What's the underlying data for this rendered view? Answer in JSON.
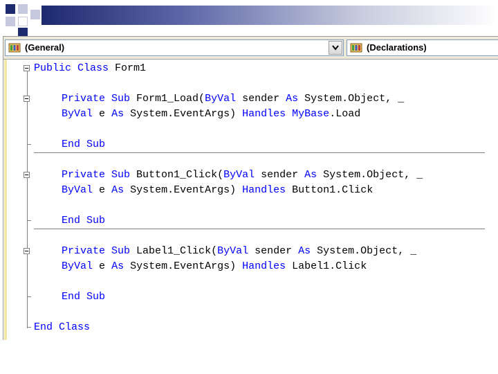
{
  "navbar": {
    "class_combo": {
      "value": "(General)"
    },
    "method_combo": {
      "value": "(Declarations)"
    }
  },
  "code": {
    "class_decl": [
      "Public Class",
      "Form1"
    ],
    "sub1_l1": [
      "Private Sub",
      "Form1_Load(",
      "ByVal",
      "sender",
      "As",
      "System.Object, _"
    ],
    "sub1_l2": [
      "ByVal",
      "e",
      "As",
      "System.EventArgs)",
      "Handles",
      "MyBase",
      ".Load"
    ],
    "sub2_l1": [
      "Private Sub",
      "Button1_Click(",
      "ByVal",
      "sender",
      "As",
      "System.Object, _"
    ],
    "sub2_l2": [
      "ByVal",
      "e",
      "As",
      "System.EventArgs)",
      "Handles",
      "Button1.Click"
    ],
    "sub3_l1": [
      "Private Sub",
      "Label1_Click(",
      "ByVal",
      "sender",
      "As",
      "System.Object, _"
    ],
    "sub3_l2": [
      "ByVal",
      "e",
      "As",
      "System.EventArgs)",
      "Handles",
      "Label1.Click"
    ],
    "end_sub": "End Sub",
    "end_class": "End Class"
  },
  "colors": {
    "keyword": "#0000ff",
    "text": "#000000",
    "margin_highlight": "#efe8a6"
  }
}
